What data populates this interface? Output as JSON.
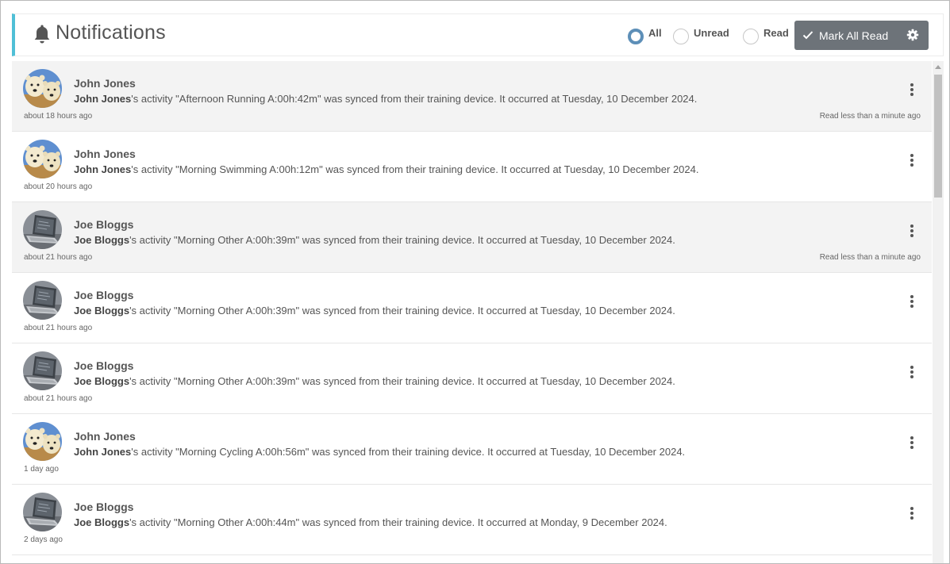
{
  "header": {
    "title": "Notifications",
    "bell_icon": "bell-icon",
    "filters": [
      {
        "label": "All",
        "checked": true
      },
      {
        "label": "Unread",
        "checked": false
      },
      {
        "label": "Read",
        "checked": false
      }
    ],
    "mark_all_label": "Mark All Read",
    "check_icon": "check-icon",
    "settings_icon": "gear-icon"
  },
  "colors": {
    "accent": "#4fbfd6",
    "button": "#6d7379",
    "radio_checked": "#5d8fb8",
    "unread_row": "#f3f3f3"
  },
  "notifications": [
    {
      "name": "John Jones",
      "avatar": "polar-bears",
      "actor": "John Jones",
      "text": "'s activity \"Afternoon Running A:00h:42m\" was synced from their training device. It occurred at Tuesday, 10 December 2024.",
      "time": "about 18 hours ago",
      "read_status": "Read less than a minute ago"
    },
    {
      "name": "John Jones",
      "avatar": "polar-bears",
      "actor": "John Jones",
      "text": "'s activity \"Morning Swimming A:00h:12m\" was synced from their training device. It occurred at Tuesday, 10 December 2024.",
      "time": "about 20 hours ago",
      "read_status": ""
    },
    {
      "name": "Joe Bloggs",
      "avatar": "laptop",
      "actor": "Joe Bloggs",
      "text": "'s activity \"Morning Other A:00h:39m\" was synced from their training device. It occurred at Tuesday, 10 December 2024.",
      "time": "about 21 hours ago",
      "read_status": "Read less than a minute ago"
    },
    {
      "name": "Joe Bloggs",
      "avatar": "laptop",
      "actor": "Joe Bloggs",
      "text": "'s activity \"Morning Other A:00h:39m\" was synced from their training device. It occurred at Tuesday, 10 December 2024.",
      "time": "about 21 hours ago",
      "read_status": ""
    },
    {
      "name": "Joe Bloggs",
      "avatar": "laptop",
      "actor": "Joe Bloggs",
      "text": "'s activity \"Morning Other A:00h:39m\" was synced from their training device. It occurred at Tuesday, 10 December 2024.",
      "time": "about 21 hours ago",
      "read_status": ""
    },
    {
      "name": "John Jones",
      "avatar": "polar-bears",
      "actor": "John Jones",
      "text": "'s activity \"Morning Cycling A:00h:56m\" was synced from their training device. It occurred at Tuesday, 10 December 2024.",
      "time": "1 day ago",
      "read_status": ""
    },
    {
      "name": "Joe Bloggs",
      "avatar": "laptop",
      "actor": "Joe Bloggs",
      "text": "'s activity \"Morning Other A:00h:44m\" was synced from their training device. It occurred at Monday, 9 December 2024.",
      "time": "2 days ago",
      "read_status": ""
    }
  ],
  "menu_icon": "kebab-menu-icon"
}
